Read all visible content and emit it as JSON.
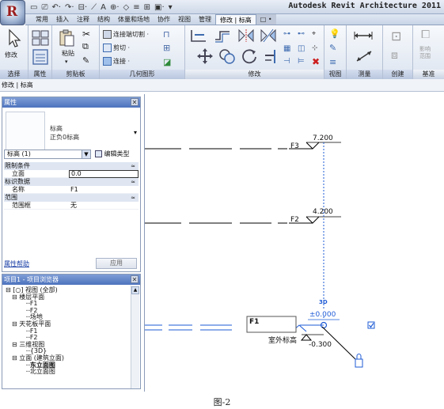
{
  "app": {
    "title": "Autodesk Revit Architecture 2011",
    "quick_access": [
      "▭",
      "⎚",
      "↶·",
      "↷·",
      "⊟·",
      "⟋",
      "A",
      "⊕·",
      "◇",
      "≡",
      "⊞",
      "▣·",
      "▾"
    ]
  },
  "ribbon": {
    "tabs": [
      "常用",
      "插入",
      "注释",
      "结构",
      "体量和场地",
      "协作",
      "视图",
      "管理",
      "修改 | 标高",
      "□ •"
    ],
    "active_tab": "修改 | 标高",
    "panels": {
      "select": "选择",
      "properties": "属性",
      "clipboard": "剪贴板",
      "geometry": "几何图形",
      "modify": "修改",
      "view": "视图",
      "measure": "测量",
      "create": "创建",
      "datum": "基准"
    },
    "buttons": {
      "modify": "修改",
      "paste": "粘贴",
      "join_cut": "连接端切割 ·",
      "cut": "剪切 ·",
      "join": "连接 ·",
      "scope_box": "影响\n范围"
    }
  },
  "options_bar": {
    "text": "修改 | 标高"
  },
  "properties": {
    "header": "属性",
    "type_family": "标高",
    "type_name": "正负0标高",
    "instance_selector": "标高 (1)",
    "edit_type": "编辑类型",
    "groups": [
      {
        "name": "限制条件",
        "rows": [
          {
            "key": "立面",
            "value": "0.0",
            "editing": true
          }
        ]
      },
      {
        "name": "标识数据",
        "rows": [
          {
            "key": "名称",
            "value": "F1"
          }
        ]
      },
      {
        "name": "范围",
        "rows": [
          {
            "key": "范围框",
            "value": "无"
          }
        ]
      }
    ],
    "help_link": "属性帮助",
    "apply_button": "应用"
  },
  "browser": {
    "header": "项目1 - 项目浏览器",
    "tree": [
      {
        "depth": 0,
        "label": "[○] 视图 (全部)",
        "toggle": "⊟"
      },
      {
        "depth": 1,
        "label": "楼层平面",
        "toggle": "⊟"
      },
      {
        "depth": 2,
        "label": "F1"
      },
      {
        "depth": 2,
        "label": "F2"
      },
      {
        "depth": 2,
        "label": "场地"
      },
      {
        "depth": 1,
        "label": "天花板平面",
        "toggle": "⊟"
      },
      {
        "depth": 2,
        "label": "F1"
      },
      {
        "depth": 2,
        "label": "F2"
      },
      {
        "depth": 1,
        "label": "三维视图",
        "toggle": "⊟"
      },
      {
        "depth": 2,
        "label": "{3D}"
      },
      {
        "depth": 1,
        "label": "立面 (建筑立面)",
        "toggle": "⊟"
      },
      {
        "depth": 2,
        "label": "东立面图",
        "bold": true
      },
      {
        "depth": 2,
        "label": "北立面图"
      }
    ]
  },
  "drawing": {
    "levels": [
      {
        "name": "F3",
        "elevation": "7.200"
      },
      {
        "name": "F2",
        "elevation": "4.200"
      },
      {
        "name": "F1",
        "elevation": "±0.000",
        "editing": true
      },
      {
        "name": "室外标高",
        "elevation": "-0.300"
      }
    ],
    "view_3d_label": "3D",
    "colors": {
      "selection": "#1e5bd6",
      "level_line": "#000000"
    }
  },
  "caption": "图-2"
}
